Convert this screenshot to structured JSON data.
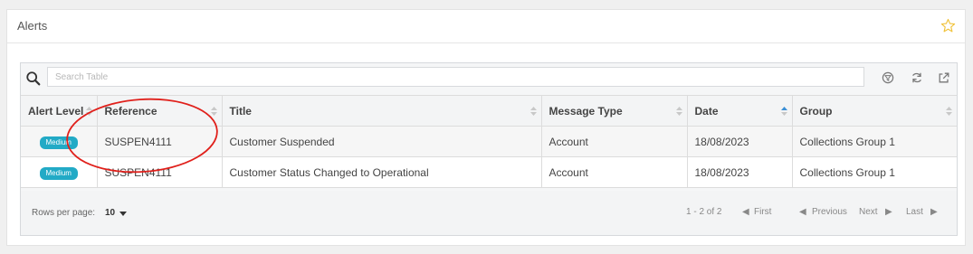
{
  "panel": {
    "title": "Alerts"
  },
  "search": {
    "placeholder": "Search Table"
  },
  "icons": {
    "search": "search-icon",
    "filter_clear": "filter-off-icon",
    "refresh": "refresh-icon",
    "export": "export-icon",
    "favorite": "star-icon"
  },
  "table": {
    "columns": [
      "Alert Level",
      "Reference",
      "Title",
      "Message Type",
      "Date",
      "Group"
    ],
    "sorted_column": "Date",
    "rows": [
      {
        "alert_level": "Medium",
        "reference": "SUSPEN4111",
        "title": "Customer Suspended",
        "message_type": "Account",
        "date": "18/08/2023",
        "group": "Collections Group 1"
      },
      {
        "alert_level": "Medium",
        "reference": "SUSPEN4111",
        "title": "Customer Status Changed to Operational",
        "message_type": "Account",
        "date": "18/08/2023",
        "group": "Collections Group 1"
      }
    ]
  },
  "footer": {
    "rows_per_page_label": "Rows per page:",
    "rows_per_page_value": "10",
    "range": "1 - 2 of 2",
    "first": "First",
    "previous": "Previous",
    "next": "Next",
    "last": "Last"
  },
  "colors": {
    "badge": "#22aac6",
    "annotation": "#e0201b",
    "star": "#f0c23a",
    "sort_active": "#3a8fd6"
  }
}
